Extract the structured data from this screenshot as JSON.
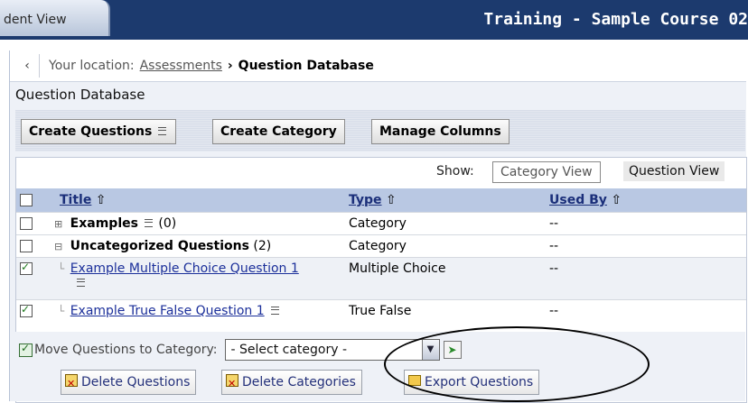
{
  "banner": {
    "tab_label": "dent View",
    "course_title": "Training - Sample Course 02"
  },
  "breadcrumb": {
    "label": "Your location:",
    "link": "Assessments",
    "separator": "›",
    "current": "Question Database"
  },
  "page_title": "Question Database",
  "toolbar": {
    "create_questions": "Create Questions",
    "create_category": "Create Category",
    "manage_columns": "Manage Columns"
  },
  "view_switch": {
    "label": "Show:",
    "category_view": "Category View",
    "question_view": "Question View"
  },
  "table": {
    "headers": {
      "title": "Title",
      "type": "Type",
      "used_by": "Used By",
      "sort_glyph": "⇧"
    },
    "rows": [
      {
        "tree": "⊞",
        "title": "Examples",
        "count": "(0)",
        "type": "Category",
        "used_by": "--",
        "checked": false
      },
      {
        "tree": "⊟",
        "title": "Uncategorized Questions",
        "count": "(2)",
        "type": "Category",
        "used_by": "--",
        "checked": false
      },
      {
        "tree": "",
        "title": "Example Multiple Choice Question 1",
        "type": "Multiple Choice",
        "used_by": "--",
        "checked": true
      },
      {
        "tree": "",
        "title": "Example True False Question 1",
        "type": "True False",
        "used_by": "--",
        "checked": true
      }
    ]
  },
  "actions": {
    "move_label": "Move Questions to Category:",
    "select_placeholder": "- Select category -",
    "delete_questions": "Delete Questions",
    "delete_categories": "Delete Categories",
    "export_questions": "Export Questions"
  }
}
